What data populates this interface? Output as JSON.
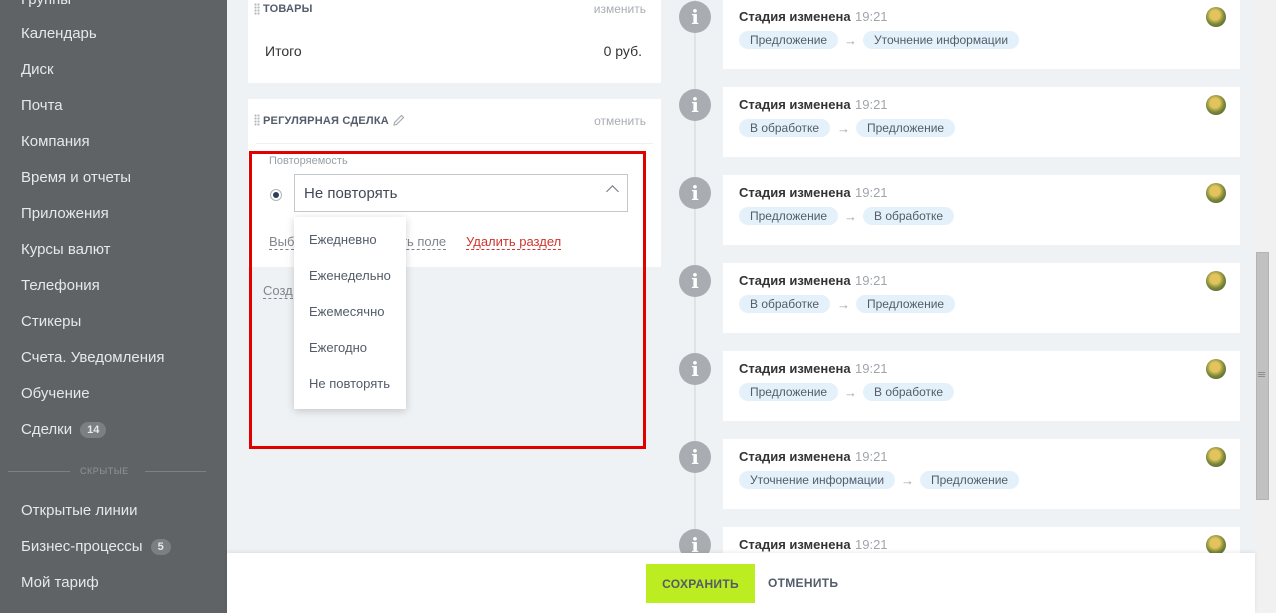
{
  "sidebar": {
    "items": [
      {
        "label": "Группы"
      },
      {
        "label": "Календарь"
      },
      {
        "label": "Диск"
      },
      {
        "label": "Почта"
      },
      {
        "label": "Компания"
      },
      {
        "label": "Время и отчеты"
      },
      {
        "label": "Приложения"
      },
      {
        "label": "Курсы валют"
      },
      {
        "label": "Телефония"
      },
      {
        "label": "Стикеры"
      },
      {
        "label": "Счета. Уведомления"
      },
      {
        "label": "Обучение"
      },
      {
        "label": "Сделки",
        "count": "14"
      }
    ],
    "hidden_label": "СКРЫТЫЕ",
    "hidden_items": [
      {
        "label": "Открытые линии"
      },
      {
        "label": "Бизнес-процессы",
        "count": "5"
      },
      {
        "label": "Мой тариф"
      }
    ]
  },
  "products": {
    "title": "ТОВАРЫ",
    "action": "изменить",
    "total_label": "Итого",
    "total_value": "0 руб."
  },
  "recurring": {
    "title": "РЕГУЛЯРНАЯ СДЕЛКА",
    "action": "отменить",
    "field_label": "Повторяемость",
    "selected": "Не повторять",
    "link_select_partial": "Выб",
    "link_add_field_partial": "ть поле",
    "link_delete": "Удалить раздел",
    "create_partial": "Созд",
    "options": [
      "Ежедневно",
      "Еженедельно",
      "Ежемесячно",
      "Ежегодно",
      "Не повторять"
    ]
  },
  "timeline": [
    {
      "title": "Стадия изменена",
      "time": "19:21",
      "from": "Предложение",
      "to": "Уточнение информации"
    },
    {
      "title": "Стадия изменена",
      "time": "19:21",
      "from": "В обработке",
      "to": "Предложение"
    },
    {
      "title": "Стадия изменена",
      "time": "19:21",
      "from": "Предложение",
      "to": "В обработке"
    },
    {
      "title": "Стадия изменена",
      "time": "19:21",
      "from": "В обработке",
      "to": "Предложение"
    },
    {
      "title": "Стадия изменена",
      "time": "19:21",
      "from": "Предложение",
      "to": "В обработке"
    },
    {
      "title": "Стадия изменена",
      "time": "19:21",
      "from": "Уточнение информации",
      "to": "Предложение"
    },
    {
      "title": "Стадия изменена",
      "time": "19:21",
      "from": "",
      "to": ""
    }
  ],
  "footer": {
    "save_label": "СОХРАНИТЬ",
    "cancel_label": "ОТМЕНИТЬ"
  },
  "icons": {
    "timeline": "info-icon",
    "avatar": "user-avatar",
    "chevron": "chevron-up-icon",
    "edit": "pencil-icon",
    "drag": "drag-handle-icon"
  },
  "colors": {
    "save_button": "#bbed21",
    "highlight": "#e00000",
    "delete_link": "#d0342c",
    "chip": "#e5f1fa",
    "sidebar": "#5f6366"
  }
}
